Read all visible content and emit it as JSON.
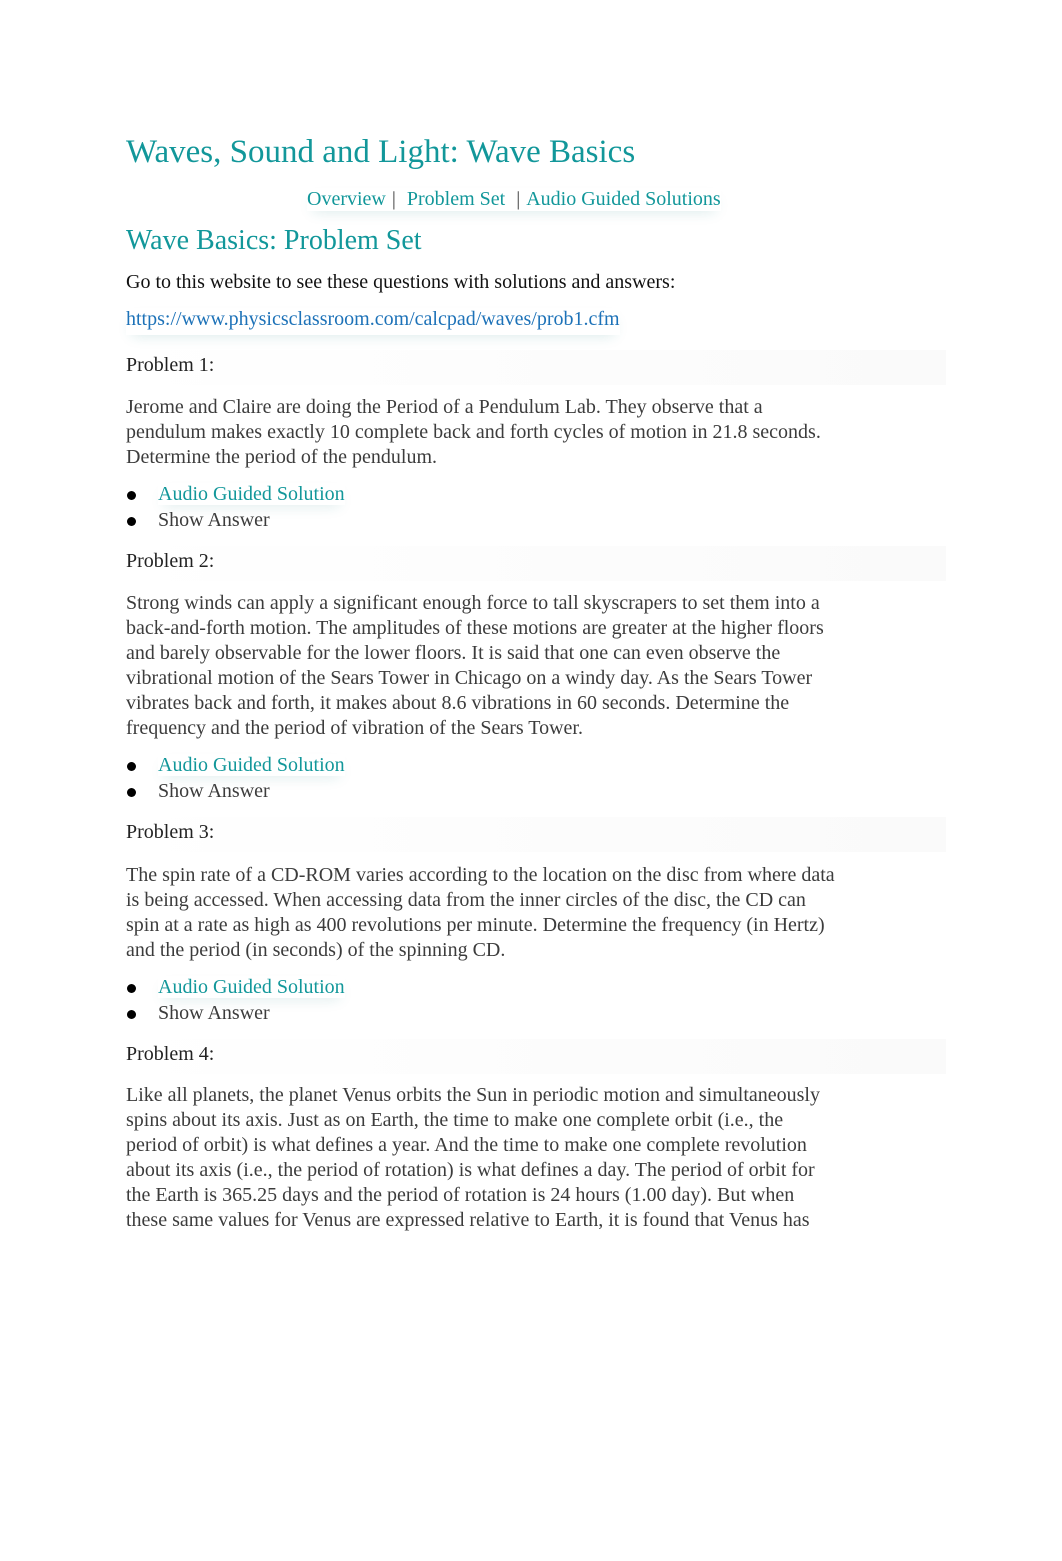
{
  "header": {
    "title": "Waves, Sound and Light: Wave Basics",
    "nav": [
      {
        "label": "Overview"
      },
      {
        "label": "Problem Set"
      },
      {
        "label": "Audio Guided Solutions"
      }
    ],
    "nav_separator": "|"
  },
  "section": {
    "title": "Wave Basics: Problem Set",
    "intro": "Go to this website to see these questions with solutions and answers:",
    "url": "https://www.physicsclassroom.com/calcpad/waves/prob1.cfm"
  },
  "problems": [
    {
      "label": "Problem 1:",
      "lines": [
        "Jerome and Claire are doing the Period of a Pendulum Lab. They observe that a",
        "pendulum makes exactly 10 complete back and forth cycles of motion in 21.8 seconds.",
        "Determine the period of the pendulum."
      ],
      "links": {
        "audio": "Audio Guided Solution",
        "answer": "Show Answer"
      }
    },
    {
      "label": "Problem 2:",
      "lines": [
        "Strong winds can apply a significant enough force to tall skyscrapers to set them into a",
        "back-and-forth motion. The amplitudes of these motions are greater at the higher floors",
        "and barely observable for the lower floors. It is said that one can even observe the",
        "vibrational motion of the Sears Tower in Chicago on a windy day. As the Sears Tower",
        "vibrates back and forth, it makes about 8.6 vibrations in 60 seconds. Determine the",
        "frequency and the period of vibration of the Sears Tower."
      ],
      "links": {
        "audio": "Audio Guided Solution",
        "answer": "Show Answer"
      }
    },
    {
      "label": "Problem 3:",
      "lines": [
        "The spin rate of a CD-ROM varies according to the location on the disc from where data",
        "is being accessed. When accessing data from the inner circles of the disc, the CD can",
        "spin at a rate as high as 400 revolutions per minute. Determine the frequency (in Hertz)",
        "and the period (in seconds) of the spinning CD."
      ],
      "links": {
        "audio": "Audio Guided Solution",
        "answer": "Show Answer"
      }
    },
    {
      "label": "Problem 4:",
      "lines": [
        "Like all planets, the planet Venus orbits the Sun in periodic motion and simultaneously",
        "spins about its axis. Just as on Earth, the time to make one complete orbit (i.e., the",
        "period of orbit) is what defines a year. And the time to make one complete revolution",
        "about its axis (i.e., the period of rotation) is what defines a day. The period of orbit for",
        "the Earth is 365.25 days and the period of rotation is 24 hours (1.00 day). But when",
        "these same values for Venus are expressed relative to Earth, it is found that Venus has"
      ]
    }
  ]
}
